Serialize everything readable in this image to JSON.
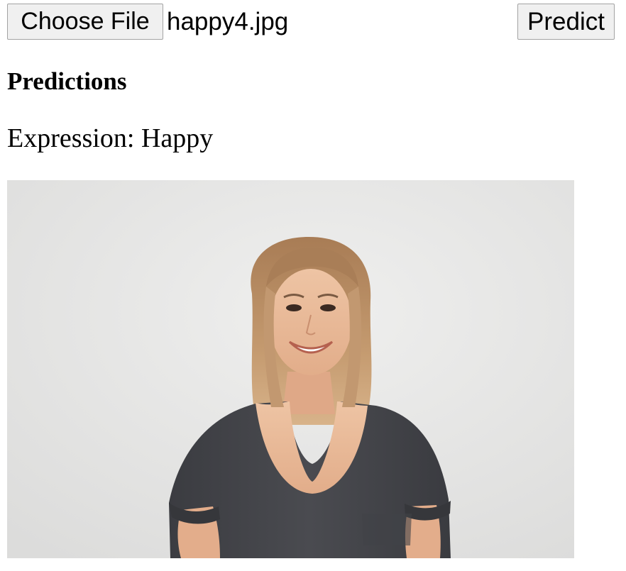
{
  "upload": {
    "choose_file_label": "Choose File",
    "file_name": "happy4.jpg"
  },
  "actions": {
    "predict_label": "Predict"
  },
  "results": {
    "heading": "Predictions",
    "expression_label": "Expression:",
    "expression_value": "Happy"
  },
  "image": {
    "subject": "smiling woman with shoulder-length blonde hair in a dark gray t-shirt against a light gray wall",
    "colors": {
      "wall": "#e8e8e7",
      "shirt": "#45464b",
      "skin": "#e8b896",
      "hair": "#b98c62"
    }
  }
}
